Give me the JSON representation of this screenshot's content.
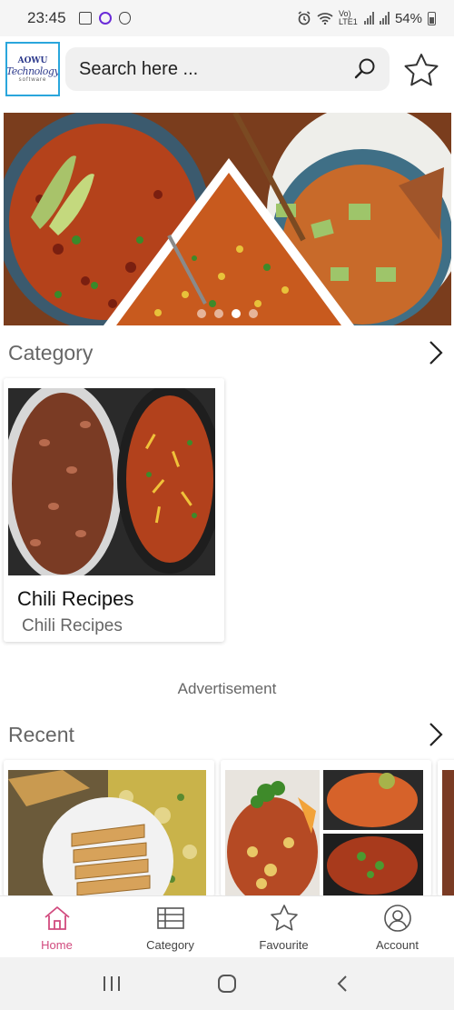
{
  "status_bar": {
    "time": "23:45",
    "battery": "54%",
    "network": "Vo) LTE1",
    "icons_left": [
      "image-notification-icon",
      "instagram-icon",
      "bug-icon"
    ],
    "icons_right": [
      "alarm-icon",
      "wifi-icon",
      "signal-icon",
      "battery-icon"
    ]
  },
  "header": {
    "logo_lines": [
      "AOWU",
      "Technology",
      "software"
    ],
    "search_placeholder": "Search here ...",
    "favourite_icon": "star-outline-icon"
  },
  "banner": {
    "slide_count": 4,
    "active_slide": 3
  },
  "category_section": {
    "title": "Category",
    "cards": [
      {
        "name": "Chili Recipes",
        "subtitle": "Chili Recipes"
      }
    ]
  },
  "advertisement": {
    "label": "Advertisement"
  },
  "recent_section": {
    "title": "Recent"
  },
  "bottom_nav": {
    "items": [
      {
        "label": "Home",
        "icon": "home-icon",
        "active": true
      },
      {
        "label": "Category",
        "icon": "list-icon",
        "active": false
      },
      {
        "label": "Favourite",
        "icon": "star-icon",
        "active": false
      },
      {
        "label": "Account",
        "icon": "account-icon",
        "active": false
      }
    ]
  },
  "colors": {
    "accent": "#d14a7e",
    "logo_border": "#2aa6dc"
  }
}
